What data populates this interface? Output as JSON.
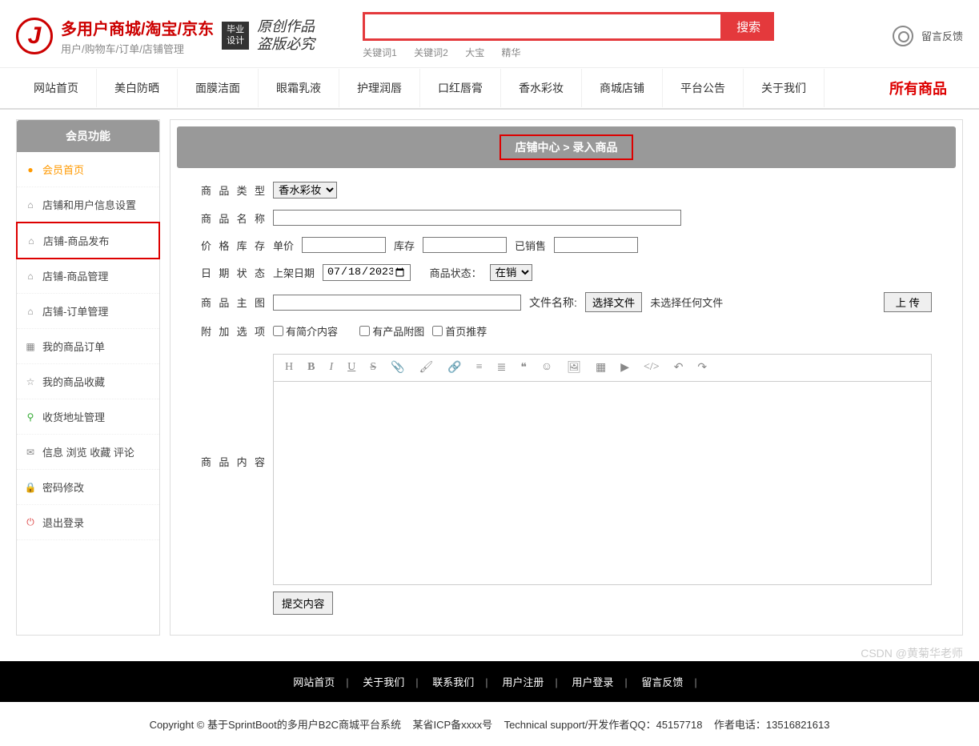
{
  "header": {
    "logo_title": "多用户商城/淘宝/京东",
    "logo_sub": "用户/购物车/订单/店铺管理",
    "badge": "毕业\n设计",
    "slogan1": "原创作品",
    "slogan2": "盗版必究",
    "search_btn": "搜索",
    "keywords": [
      "关键词1",
      "关键词2",
      "大宝",
      "精华"
    ],
    "feedback": "留言反馈"
  },
  "nav": {
    "items": [
      "网站首页",
      "美白防晒",
      "面膜洁面",
      "眼霜乳液",
      "护理润唇",
      "口红唇膏",
      "香水彩妆",
      "商城店铺",
      "平台公告",
      "关于我们"
    ],
    "all": "所有商品"
  },
  "sidebar": {
    "title": "会员功能",
    "items": [
      {
        "icon": "●",
        "label": "会员首页",
        "cls": "active-home",
        "color": "#f90"
      },
      {
        "icon": "⌂",
        "label": "店铺和用户信息设置",
        "color": "#888"
      },
      {
        "icon": "⌂",
        "label": "店铺-商品发布",
        "cls": "highlighted",
        "color": "#888"
      },
      {
        "icon": "⌂",
        "label": "店铺-商品管理",
        "color": "#888"
      },
      {
        "icon": "⌂",
        "label": "店铺-订单管理",
        "color": "#888"
      },
      {
        "icon": "▦",
        "label": "我的商品订单",
        "color": "#888"
      },
      {
        "icon": "☆",
        "label": "我的商品收藏",
        "color": "#888"
      },
      {
        "icon": "⚲",
        "label": "收货地址管理",
        "color": "#3a3"
      },
      {
        "icon": "✉",
        "label": "信息 浏览 收藏 评论",
        "color": "#888"
      },
      {
        "icon": "🔒",
        "label": "密码修改",
        "color": "#f90"
      },
      {
        "icon": "⏻",
        "label": "退出登录",
        "color": "#d44"
      }
    ]
  },
  "breadcrumb": {
    "left": "店铺中心",
    "right": "录入商品",
    "sep": " > "
  },
  "form": {
    "type_label": "商品类型",
    "type_value": "香水彩妆",
    "name_label": "商品名称",
    "name_value": "",
    "stock_label": "价格库存",
    "price_label": "单价",
    "stock_text": "库存",
    "sold_text": "已销售",
    "date_label": "日期状态",
    "date_text": "上架日期",
    "date_value": "2023/07/18",
    "status_text": "商品状态：",
    "status_value": "在销",
    "image_label": "商品主图",
    "file_label": "文件名称:",
    "file_btn": "选择文件",
    "file_status": "未选择任何文件",
    "upload_btn": "上 传",
    "addon_label": "附加选项",
    "cb1": "有简介内容",
    "cb2": "有产品附图",
    "cb3": "首页推荐",
    "content_label": "商品内容",
    "submit": "提交内容"
  },
  "editor_toolbar": [
    "H",
    "B",
    "I",
    "U",
    "S",
    "📎",
    "🖌",
    "🔗",
    "≡",
    "≣",
    "❝",
    "☺",
    "🖼",
    "▦",
    "▶",
    "</>",
    "↶",
    "↷"
  ],
  "footer": {
    "nav": [
      "网站首页",
      "关于我们",
      "联系我们",
      "用户注册",
      "用户登录",
      "留言反馈"
    ],
    "copyright": "Copyright © 基于SprintBoot的多用户B2C商城平台系统",
    "icp": "某省ICP备xxxx号",
    "support": "Technical support/开发作者QQ：45157718",
    "phone": "作者电话：13516821613"
  },
  "watermark": "CSDN @黄菊华老师"
}
